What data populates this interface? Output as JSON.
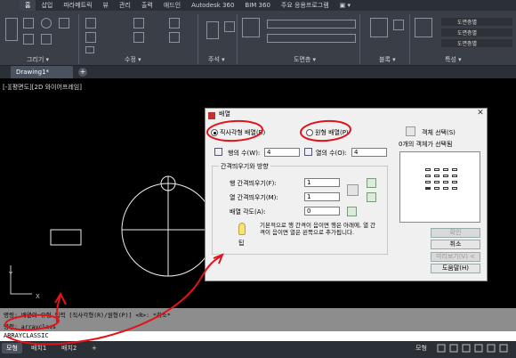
{
  "menubar": {
    "tabs": [
      "홈",
      "삽입",
      "파라메트릭",
      "뷰",
      "관리",
      "출력",
      "애드인",
      "Autodesk 360",
      "BIM 360",
      "주요 응용프로그램",
      "▣ ▾"
    ],
    "active_index": 0
  },
  "ribbon": {
    "panels": [
      "그리기 ▾",
      "수정 ▾",
      "주석 ▾",
      "도면층 ▾",
      "블록 ▾",
      "특성 ▾"
    ],
    "layer_props": [
      "도면층별",
      "도면층별",
      "도면층별"
    ]
  },
  "doc_tabs": {
    "active": "Drawing1*",
    "add": "+"
  },
  "viewport_label": "[-][평면도][2D 와이어프레임]",
  "command": {
    "history_line1": "명령: 배열의 유형 입력 [직사각형(R)/원형(P)] <R>: *취소*",
    "history_line2": "명령: arrayclass",
    "input": "ARRAYCLASSIC"
  },
  "status": {
    "tabs": [
      "모형",
      "배치1",
      "배치2",
      "+"
    ],
    "right_model": "모형"
  },
  "dialog": {
    "title": "배열",
    "close": "✕",
    "rect_array": "직사각형 배열(R)",
    "polar_array": "원형 배열(P)",
    "select_objects": "객체 선택(S)",
    "selected_count": "0개의 객체가 선택됨",
    "rows_label": "행의 수(W):",
    "rows_value": "4",
    "cols_label": "열의 수(O):",
    "cols_value": "4",
    "offset_group": "간격띄우기와 방향",
    "row_offset_label": "행 간격띄우기(F):",
    "row_offset_value": "1",
    "col_offset_label": "열 간격띄우기(M):",
    "col_offset_value": "1",
    "angle_label": "배열 각도(A):",
    "angle_value": "0",
    "tip_text": "기본적으로 행 간격이 음이면 행은 아래에, 열 간격이 음이면 열은 왼쪽으로 추가됩니다.",
    "tip_label": "팁",
    "buttons": {
      "ok": "확인",
      "cancel": "취소",
      "preview": "미리보기(V) <",
      "help": "도움말(H)"
    }
  }
}
